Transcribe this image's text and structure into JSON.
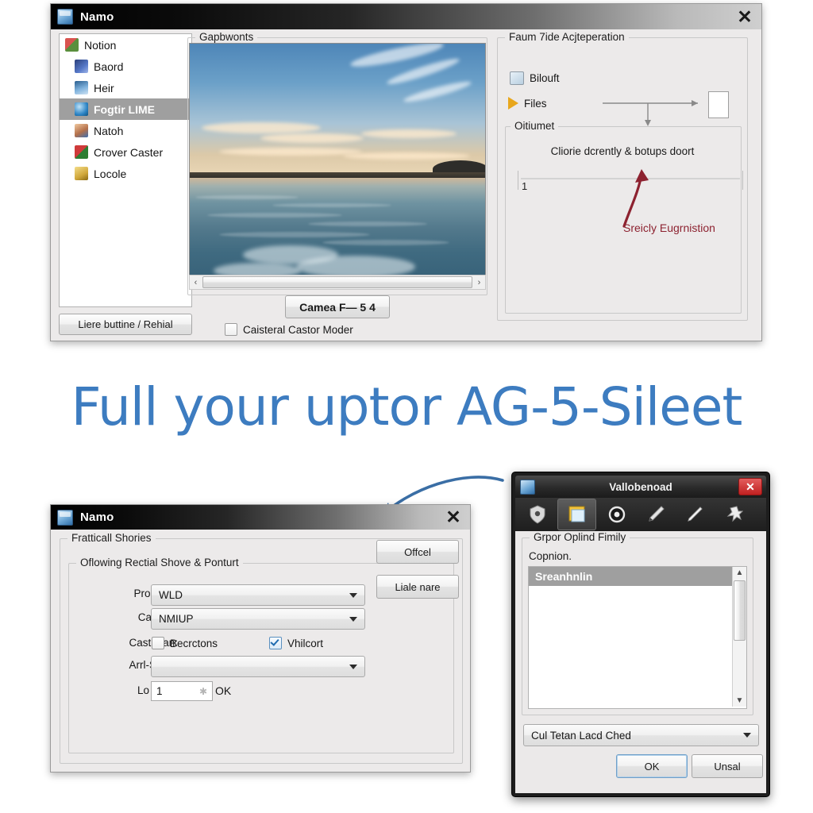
{
  "page": {
    "background": "#ffffff",
    "heading": "Full your uptor AG-5-Sileet",
    "heading_color": "#3d7cc0"
  },
  "top_window": {
    "title": "Namo",
    "title_icon": "app-icon",
    "close_icon": "✕",
    "sidebar": {
      "items": [
        {
          "label": "Notion",
          "icon": "notion-icon",
          "selected": false
        },
        {
          "label": "Baord",
          "icon": "board-icon",
          "selected": false
        },
        {
          "label": "Heir",
          "icon": "monitor-icon",
          "selected": false
        },
        {
          "label": "Fogtir LIME",
          "icon": "globe-icon",
          "selected": true
        },
        {
          "label": "Natoh",
          "icon": "person-icon",
          "selected": false
        },
        {
          "label": "Crover Caster",
          "icon": "books-icon",
          "selected": false
        },
        {
          "label": "Locole",
          "icon": "folder-icon",
          "selected": false
        }
      ]
    },
    "restore_button": "Liere buttine / Rehial",
    "preview": {
      "legend": "Gapbwonts",
      "image_alt": "seascape at dusk with rippled water and distant shoreline",
      "scroll_left_icon": "‹",
      "scroll_right_icon": "›"
    },
    "camera_button": "Camea F— 5 4",
    "castor_checkbox": {
      "label": "Caisteral Castor Moder",
      "checked": false
    },
    "right_panel": {
      "legend": "Faum 7ide Acjteperation",
      "blouft": {
        "label": "Bilouft",
        "icon": "checkbox-window-icon"
      },
      "files": {
        "label": "Files",
        "icon": "play-triangle-icon"
      },
      "sub_legend": "Oitiumet",
      "caption": "Cliorie dcrently & botups doort",
      "slider_value": "1",
      "annotation": "Sreicly Eugrnistion",
      "annotation_color": "#8d2230"
    }
  },
  "bottom_left_window": {
    "title": "Namo",
    "close_icon": "✕",
    "outer_legend": "Fratticall Shories",
    "inner_legend": "Oflowing Rectial Shove & Ponturt",
    "buttons": {
      "offcel": "Offcel",
      "liale_nare": "Liale nare"
    },
    "fields": [
      {
        "label": "Proderte;",
        "value": "WLD",
        "type": "combo"
      },
      {
        "label": "Cansunt",
        "value": "NMIUP",
        "type": "combo"
      },
      {
        "label": "Arrl-Seart:",
        "value": "",
        "type": "combo"
      }
    ],
    "checkbox_row": {
      "label": "Castridan:",
      "items": [
        {
          "label": "Becrctons",
          "checked": false
        },
        {
          "label": "Vhilcort",
          "checked": true
        }
      ]
    },
    "spinner_row": {
      "label": "Lo Dute:",
      "value": "1",
      "ok": "OK"
    }
  },
  "bottom_right_window": {
    "title": "Vallobenoad",
    "close_icon": "✕",
    "toolbar": [
      {
        "icon": "shield-icon",
        "active": false
      },
      {
        "icon": "notepad-icon",
        "active": true
      },
      {
        "icon": "target-eye-icon",
        "active": false
      },
      {
        "icon": "pen-icon",
        "active": false
      },
      {
        "icon": "pencil-icon",
        "active": false
      },
      {
        "icon": "pin-star-icon",
        "active": false
      }
    ],
    "group_legend": "Grpor Oplind Fimily",
    "sub_label": "Copnion.",
    "list_items": [
      {
        "label": "Sreanhnlin",
        "selected": true
      }
    ],
    "scroll_up_icon": "▲",
    "scroll_down_icon": "▼",
    "combo_value": "Cul Tetan Lacd Ched",
    "buttons": {
      "ok": "OK",
      "cancel": "Unsal"
    }
  }
}
